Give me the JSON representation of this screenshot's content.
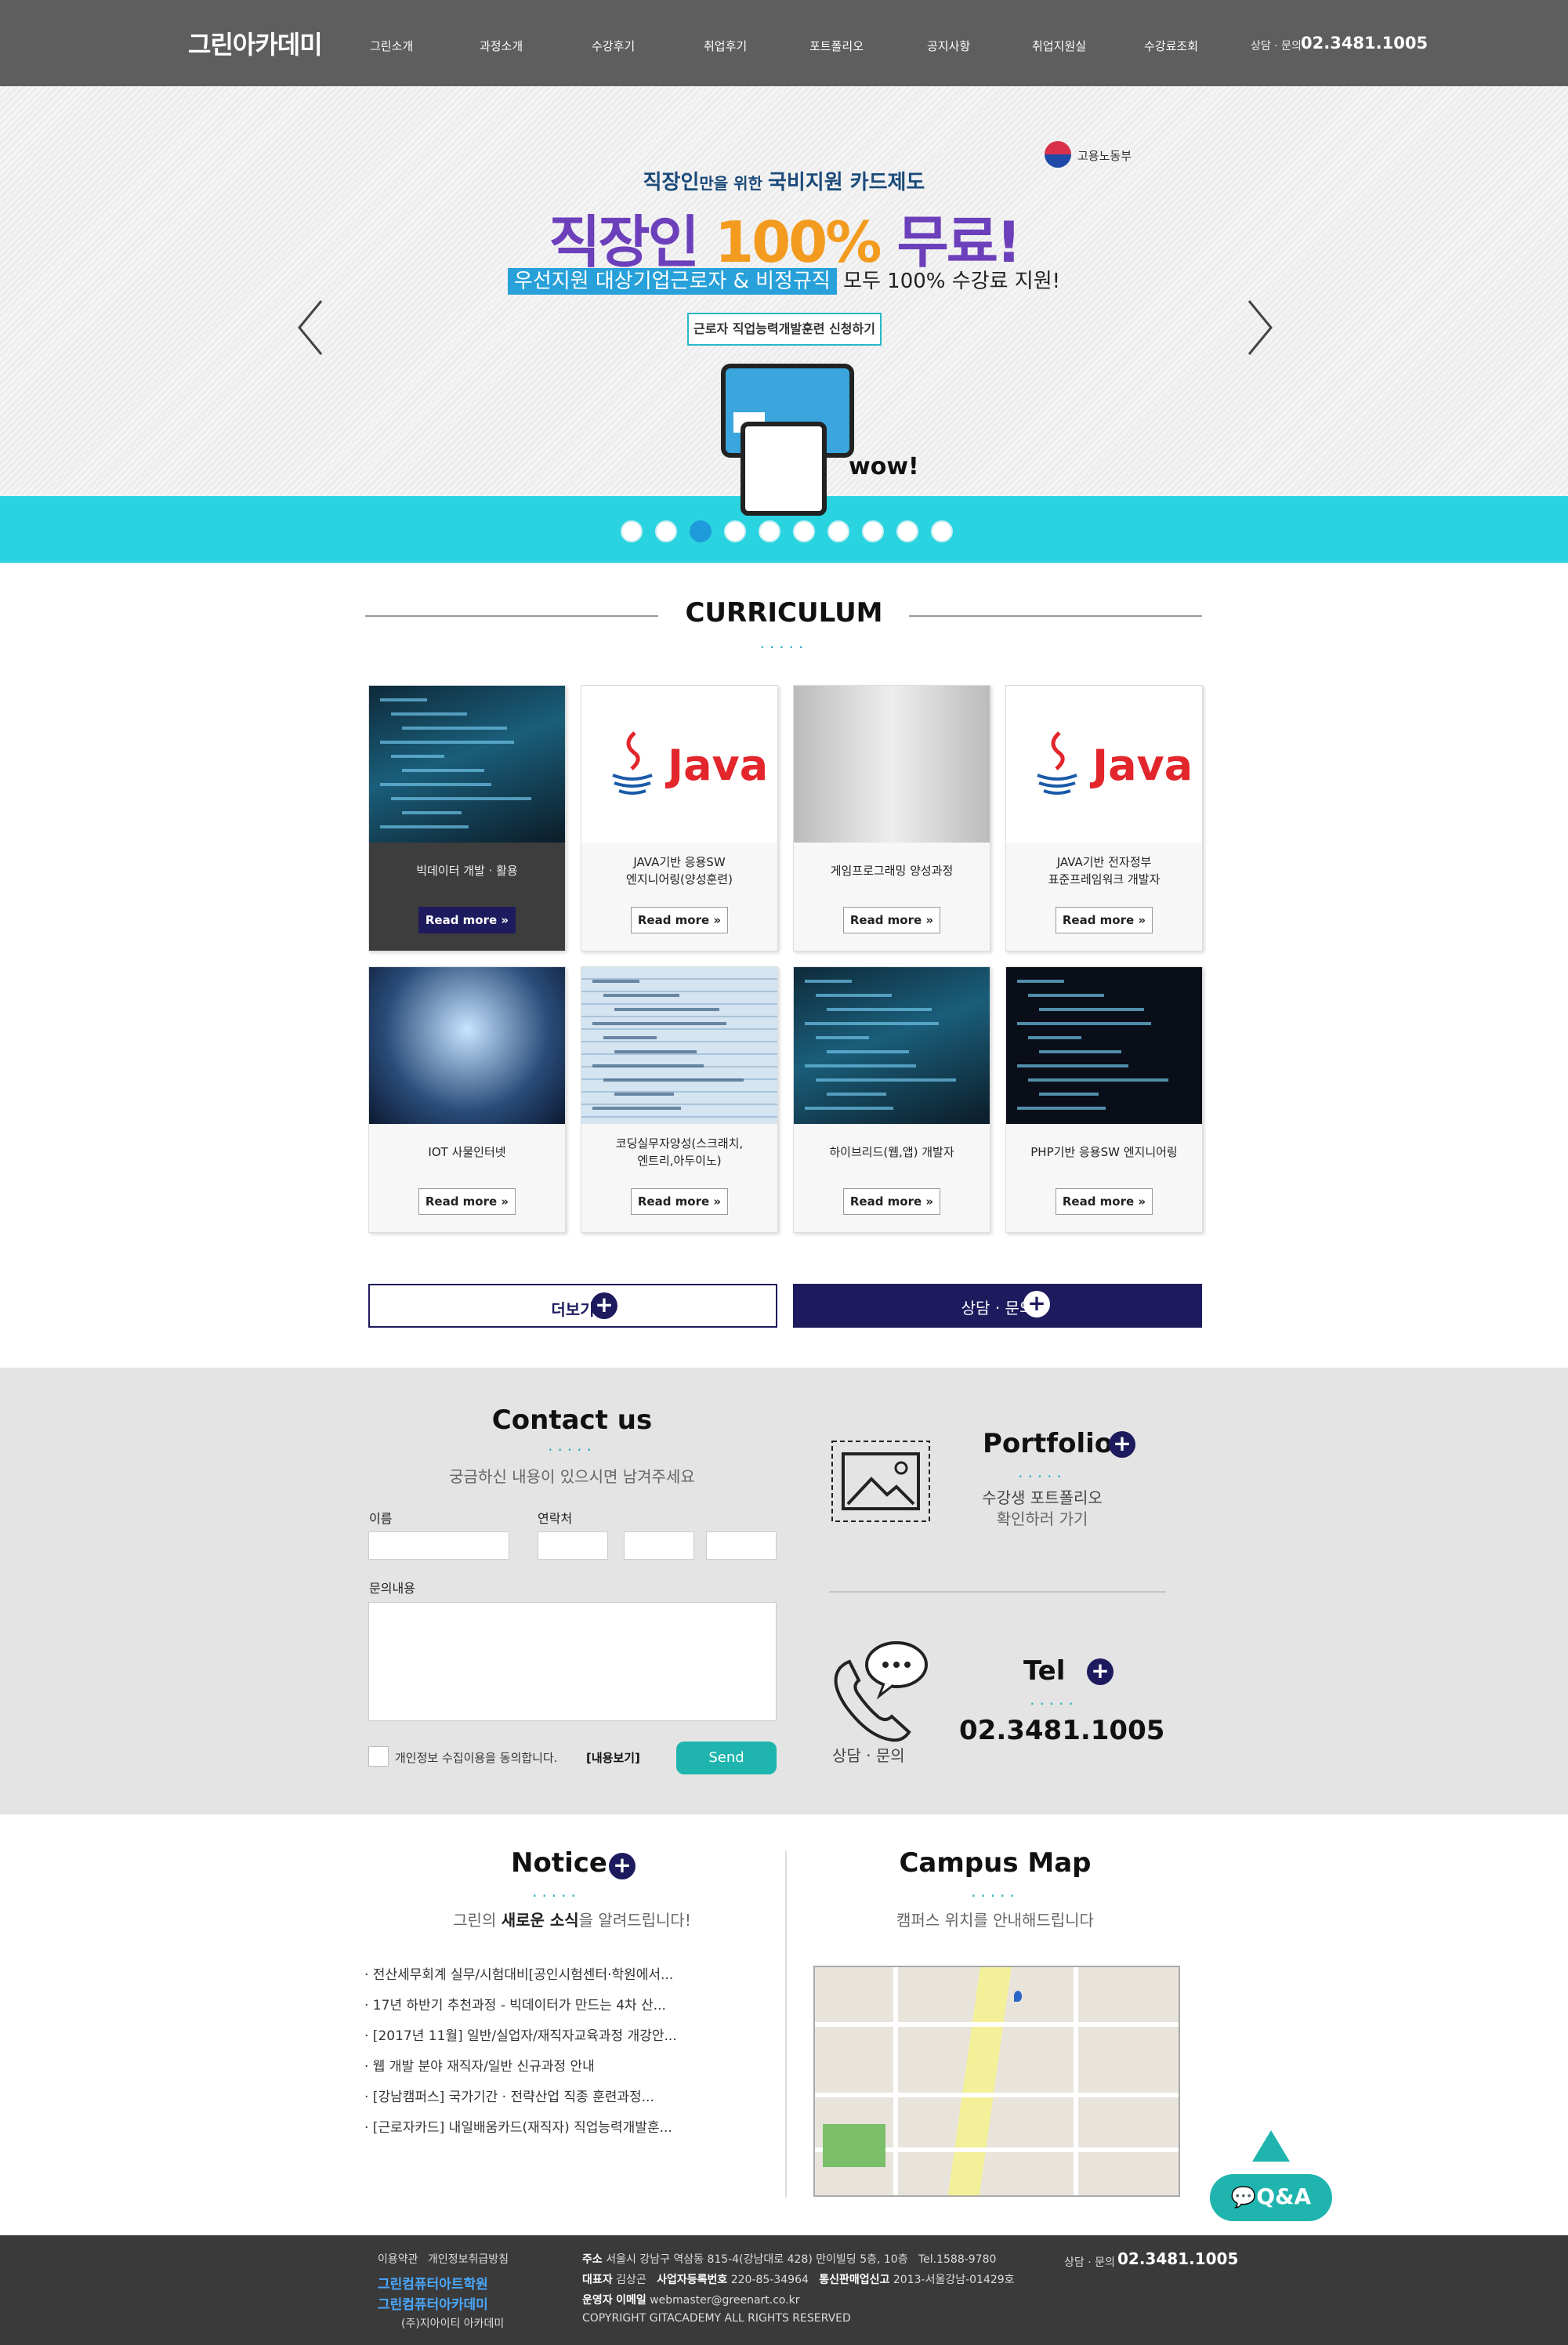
{
  "header": {
    "logo": "그린아카데미",
    "nav": [
      "그린소개",
      "과정소개",
      "수강후기",
      "취업후기",
      "포트폴리오",
      "공지사항",
      "취업지원실",
      "수강료조회"
    ],
    "consult_label": "상담 · 문의",
    "phone": "02.3481.1005"
  },
  "banner": {
    "agency": "고용노동부",
    "subtitle_pre": "직장인",
    "subtitle_mid": "만을 위한 ",
    "subtitle_post": "국비지원 카드제도",
    "title_pre": "직장인 ",
    "title_hl": "100%",
    "title_post": " 무료!",
    "line_hl": "우선지원 대상기업근로자 & 비정규직",
    "line_post": " 모두 100% 수강료 지원!",
    "button": "근로자 직업능력개발훈련 신청하기",
    "wow": "wow!",
    "slide_count": 10,
    "active_slide": 3,
    "strip_color": "#29d4e0"
  },
  "curriculum": {
    "title": "CURRICULUM",
    "dots": ".....",
    "read_more": "Read more",
    "java_logo": "Java",
    "cards": [
      {
        "caption": "빅데이터 개발 · 활용",
        "image": "code"
      },
      {
        "caption": "JAVA기반 응용SW\n엔지니어링(양성훈련)",
        "image": "java"
      },
      {
        "caption": "게임프로그래밍 양성과정",
        "image": "robot"
      },
      {
        "caption": "JAVA기반 전자정부\n표준프레임워크 개발자",
        "image": "java"
      },
      {
        "caption": "IOT 사물인터넷",
        "image": "iot"
      },
      {
        "caption": "코딩실무자양성(스크래치,\n엔트리,아두이노)",
        "image": "html"
      },
      {
        "caption": "하이브리드(웹,앱) 개발자",
        "image": "code"
      },
      {
        "caption": "PHP기반 응용SW 엔지니어링",
        "image": "php"
      }
    ],
    "more_button": "더보기",
    "consult_button": "상담 · 문의"
  },
  "contact": {
    "title": "Contact us",
    "dots": ".....",
    "subtitle": "궁금하신 내용이 있으시면 남겨주세요",
    "name_label": "이름",
    "phone_label": "연락처",
    "message_label": "문의내용",
    "agree_text": "개인정보 수집이용을 동의합니다.",
    "agree_link": "[내용보기]",
    "send": "Send"
  },
  "portfolio": {
    "title": "Portfolio",
    "dots": ".....",
    "line1": "수강생 포트폴리오",
    "line2": "확인하러 가기"
  },
  "tel": {
    "title": "Tel",
    "dots": ".....",
    "number": "02.3481.1005",
    "icon_label": "상담 · 문의"
  },
  "notice": {
    "title": "Notice",
    "dots": ".....",
    "subtitle_pre": "그린의 ",
    "subtitle_hl": "새로운 소식",
    "subtitle_post": "을 알려드립니다!",
    "items": [
      "· 전산세무회계 실무/시험대비[공인시험센터·학원에서...",
      "· 17년 하반기 추천과정 - 빅데이터가 만드는 4차 산...",
      "· [2017년 11월] 일반/실업자/재직자교육과정 개강안...",
      "· 웹 개발 분야 재직자/일반 신규과정 안내",
      "· [강남캠퍼스] 국가기간 · 전략산업 직종 훈련과정...",
      "· [근로자카드] 내일배움카드(재직자) 직업능력개발훈..."
    ]
  },
  "campus": {
    "title": "Campus Map",
    "dots": ".....",
    "subtitle": "캠퍼스 위치를 안내해드립니다"
  },
  "qa_button": "Q&A",
  "footer": {
    "links": [
      "이용약관",
      "개인정보취급방침"
    ],
    "logo1": "그린컴퓨터아트학원",
    "logo2": "그린컴퓨터아카데미",
    "company": "(주)지아이티 아카데미",
    "addr_label": "주소",
    "addr": "서울시 강남구 역삼동 815-4(강남대로 428) 만이빌딩 5층, 10층",
    "tel_label": "Tel.",
    "tel": "1588-9780",
    "ceo_label": "대표자",
    "ceo": "김상곤",
    "biz_label": "사업자등록번호",
    "biz": "220-85-34964",
    "sales_label": "통신판매업신고",
    "sales": "2013-서울강남-01429호",
    "admin_label": "운영자",
    "admin_role": "이메일",
    "email": "webmaster@greenart.co.kr",
    "copyright": "COPYRIGHT GITACADEMY ALL RIGHTS RESERVED",
    "consult_label": "상담 · 문의",
    "phone": "02.3481.1005"
  }
}
